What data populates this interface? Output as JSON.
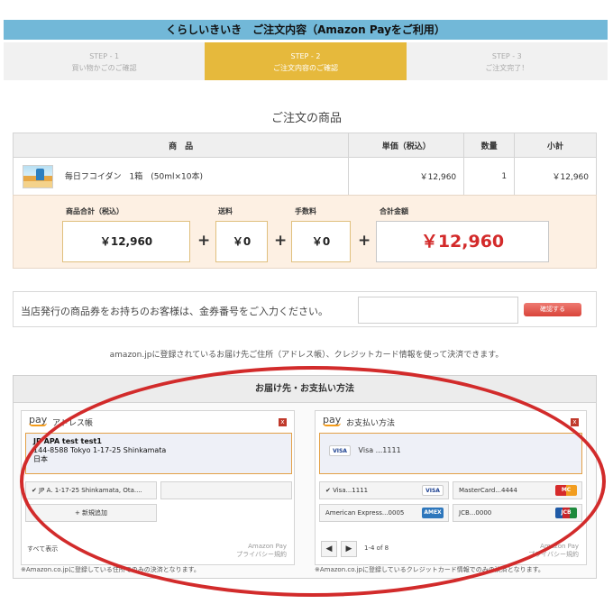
{
  "header": {
    "title": "くらしいきいき　ご注文内容（Amazon Payをご利用）"
  },
  "steps": [
    {
      "step": "STEP - 1",
      "label": "買い物かごのご確認"
    },
    {
      "step": "STEP - 2",
      "label": "ご注文内容のご確認"
    },
    {
      "step": "STEP - 3",
      "label": "ご注文完了！"
    }
  ],
  "order": {
    "section_title": "ご注文の商品",
    "columns": [
      "商　品",
      "単価（税込）",
      "数量",
      "小計"
    ],
    "item": {
      "name": "毎日フコイダン　1箱　(50ml×10本)",
      "unit_price": "￥12,960",
      "quantity": "1",
      "subtotal": "￥12,960"
    }
  },
  "totals": {
    "goods_label": "商品合計（税込）",
    "goods_value": "￥12,960",
    "shipping_label": "送料",
    "shipping_value": "￥0",
    "fee_label": "手数料",
    "fee_value": "￥0",
    "grand_label": "合計金額",
    "grand_value": "￥12,960",
    "plus": "+"
  },
  "voucher": {
    "text": "当店発行の商品券をお持ちのお客様は、金券番号をご入力ください。",
    "button": "確認する"
  },
  "amazon_note": "amazon.jpに登録されているお届け先ご住所（アドレス帳）、クレジットカード情報を使って決済できます。",
  "delivery_payment": {
    "title": "お届け先・お支払い方法",
    "address_book": {
      "logo": "pay",
      "title": "アドレス帳",
      "close": "x",
      "selected": {
        "name": "JP APA test test1",
        "line1": "144-8588 Tokyo 1-17-25 Shinkamata",
        "line2": "日本"
      },
      "option1": "JP A. 1-17-25 Shinkamata, Ota....",
      "add_new": "+ 新規追加",
      "show_all": "すべて表示",
      "footer1": "Amazon Pay",
      "footer2": "プライバシー規約",
      "note": "※Amazon.co.jpに登録している住所でのみの決済となります。"
    },
    "payment": {
      "logo": "pay",
      "title": "お支払い方法",
      "close": "x",
      "selected": "Visa ...1111",
      "selected_badge": "VISA",
      "cards": [
        {
          "label": "Visa...1111",
          "badge": "VISA"
        },
        {
          "label": "MasterCard...4444",
          "badge": "MC"
        },
        {
          "label": "American Express...0005",
          "badge": "AMEX"
        },
        {
          "label": "JCB...0000",
          "badge": "JCB"
        }
      ],
      "pager": "1-4 of 8",
      "footer1": "Amazon Pay",
      "footer2": "プライバシー規約",
      "note": "※Amazon.co.jpに登録しているクレジットカード情報でのみの決済となります。"
    }
  },
  "colors": {
    "title_bar": "#72b8d8",
    "active_step": "#e6b93c",
    "totals_bg": "#fdf0e3",
    "grand_total": "#d32a2a",
    "annotation_ring": "#d22b2b"
  }
}
